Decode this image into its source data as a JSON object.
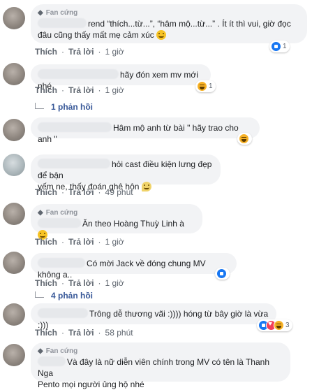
{
  "colors": {
    "link": "#385898",
    "meta": "#606770",
    "bubble": "#f2f3f5",
    "like": "#1877f2",
    "haha": "#f7b125"
  },
  "badge_label": "Fan cứng",
  "actions": {
    "like": "Thích",
    "reply": "Trả lời",
    "sep": "·"
  },
  "comments": [
    {
      "badge": true,
      "text_line1": "rend “thích...từ...”, “hâm mộ...từ...” . Ít ít thì vui, giờ đọc",
      "text_line2": "đâu cũng thấy mất mẹ cảm xúc",
      "time": "1 giờ",
      "reactions": [
        "like"
      ],
      "reaction_count": "1"
    },
    {
      "badge": false,
      "text": "hãy đón xem mv mới nhé",
      "time": "1 giờ",
      "reactions": [
        "haha"
      ],
      "reaction_count": "1",
      "replies": "1 phản hồi"
    },
    {
      "badge": false,
      "text": "Hâm mộ anh từ bài \" hãy trao cho anh \"",
      "reactions": [
        "haha"
      ],
      "reaction_count": ""
    },
    {
      "badge": false,
      "text_line1": "hỏi cast điều kiện lưng đẹp để bận",
      "text_line2": "yếm ne, thấy đoán ghê hôn",
      "time": "49 phút"
    },
    {
      "badge": true,
      "text": "Ăn theo Hoàng Thuỳ Linh à",
      "time": "1 giờ"
    },
    {
      "badge": false,
      "text": "Có mời Jack về đóng chung MV không a..",
      "time": "1 giờ",
      "reactions": [
        "like"
      ],
      "reaction_count": "",
      "replies": "4 phản hồi"
    },
    {
      "badge": false,
      "text": "Trông dễ thương vãi :)))) hóng từ bây giờ là vừa :)))",
      "time": "58 phút",
      "reactions": [
        "like",
        "love",
        "haha"
      ],
      "reaction_count": "3"
    },
    {
      "badge": true,
      "text_line1": "Và đây là nữ diễn viên chính trong MV có tên là Thanh Nga",
      "text_line2": "Pento mọi người ủng hộ nhé"
    }
  ]
}
